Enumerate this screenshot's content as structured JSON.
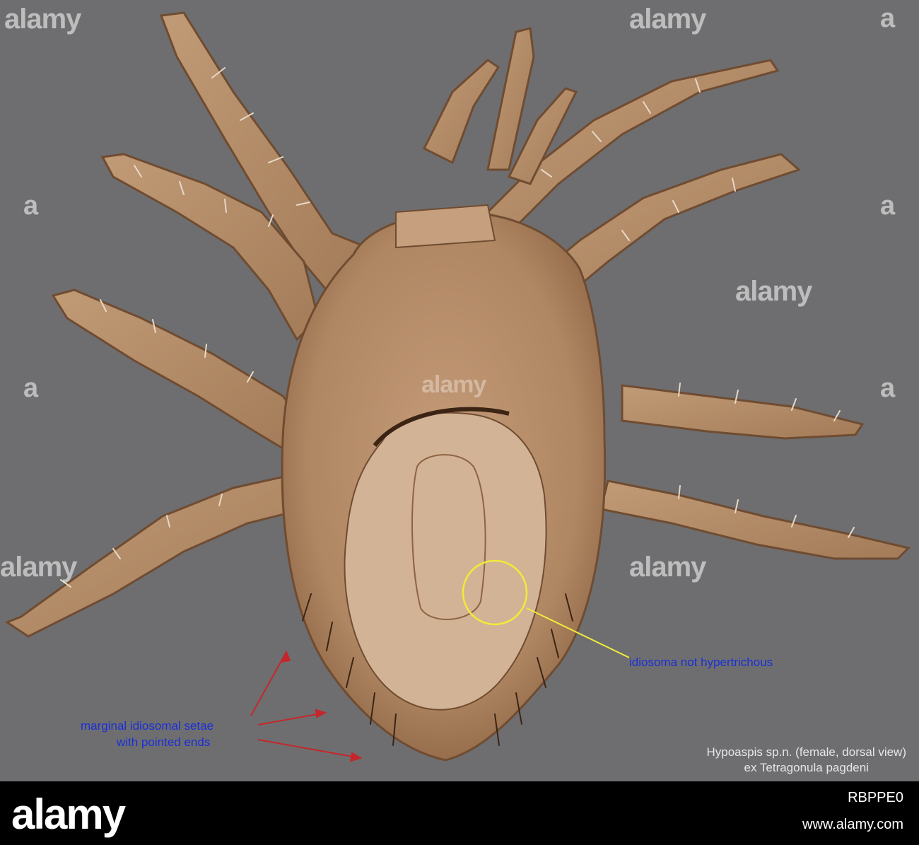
{
  "annotations": {
    "right_label": "idiosoma not hypertrichous",
    "left_label_line1": "marginal idiosomal setae",
    "left_label_line2": "with pointed ends",
    "caption_line1": "Hypoaspis sp.n. (female, dorsal view)",
    "caption_line2": "ex Tetragonula pagdeni"
  },
  "watermark": {
    "text": "alamy",
    "side_mark": "a"
  },
  "footer": {
    "logo": "alamy",
    "image_id": "RBPPE0",
    "url": "www.alamy.com"
  },
  "colors": {
    "background": "#6e6e70",
    "specimen": "#b08763",
    "label_text": "#1a2fd6",
    "circle": "#f2ea3a",
    "arrows": "#c4272b"
  }
}
